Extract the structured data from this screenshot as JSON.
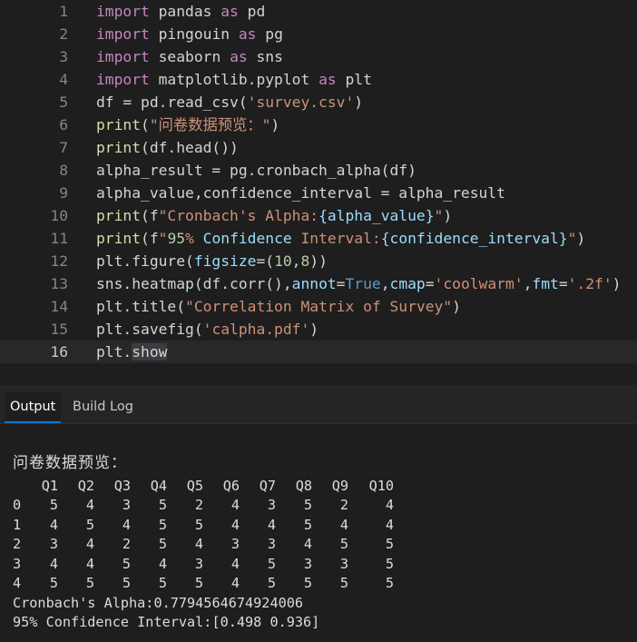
{
  "editor": {
    "current_line": 16,
    "lines": [
      {
        "n": "1",
        "tokens": [
          [
            "import",
            "k-import"
          ],
          [
            " pandas ",
            "k-plain"
          ],
          [
            "as",
            "k-import"
          ],
          [
            " pd",
            "k-plain"
          ]
        ]
      },
      {
        "n": "2",
        "tokens": [
          [
            "import",
            "k-import"
          ],
          [
            " pingouin ",
            "k-plain"
          ],
          [
            "as",
            "k-import"
          ],
          [
            " pg",
            "k-plain"
          ]
        ]
      },
      {
        "n": "3",
        "tokens": [
          [
            "import",
            "k-import"
          ],
          [
            " seaborn ",
            "k-plain"
          ],
          [
            "as",
            "k-import"
          ],
          [
            " sns",
            "k-plain"
          ]
        ]
      },
      {
        "n": "4",
        "tokens": [
          [
            "import",
            "k-import"
          ],
          [
            " matplotlib.pyplot ",
            "k-plain"
          ],
          [
            "as",
            "k-import"
          ],
          [
            " plt",
            "k-plain"
          ]
        ]
      },
      {
        "n": "5",
        "tokens": [
          [
            "df = pd.read_csv(",
            "k-plain"
          ],
          [
            "'survey.csv'",
            "k-str"
          ],
          [
            ")",
            "k-plain"
          ]
        ]
      },
      {
        "n": "6",
        "tokens": [
          [
            "print",
            "k-fn"
          ],
          [
            "(",
            "k-plain"
          ],
          [
            "\"问卷数据预览：\"",
            "k-str"
          ],
          [
            ")",
            "k-plain"
          ]
        ]
      },
      {
        "n": "7",
        "tokens": [
          [
            "print",
            "k-fn"
          ],
          [
            "(df.head())",
            "k-plain"
          ]
        ]
      },
      {
        "n": "8",
        "tokens": [
          [
            "alpha_result = pg.cronbach_alpha(df)",
            "k-plain"
          ]
        ]
      },
      {
        "n": "9",
        "tokens": [
          [
            "alpha_value,confidence_interval = alpha_result",
            "k-plain"
          ]
        ]
      },
      {
        "n": "10",
        "tokens": [
          [
            "print",
            "k-fn"
          ],
          [
            "(f",
            "k-plain"
          ],
          [
            "\"Cronbach's Alpha:",
            "k-str"
          ],
          [
            "{alpha_value}",
            "k-param"
          ],
          [
            "\"",
            "k-str"
          ],
          [
            ")",
            "k-plain"
          ]
        ]
      },
      {
        "n": "11",
        "tokens": [
          [
            "print",
            "k-fn"
          ],
          [
            "(f",
            "k-plain"
          ],
          [
            "\"",
            "k-str"
          ],
          [
            "95",
            "k-num"
          ],
          [
            "% ",
            "k-str"
          ],
          [
            "Confidence",
            "k-param"
          ],
          [
            " Interval:",
            "k-str"
          ],
          [
            "{confidence_interval}",
            "k-param"
          ],
          [
            "\"",
            "k-str"
          ],
          [
            ")",
            "k-plain"
          ]
        ]
      },
      {
        "n": "12",
        "tokens": [
          [
            "plt.figure(",
            "k-plain"
          ],
          [
            "figsize",
            "k-param"
          ],
          [
            "=(",
            "k-plain"
          ],
          [
            "10",
            "k-num"
          ],
          [
            ",",
            "k-plain"
          ],
          [
            "8",
            "k-num"
          ],
          [
            "))",
            "k-plain"
          ]
        ]
      },
      {
        "n": "13",
        "tokens": [
          [
            "sns.heatmap(df.corr(),",
            "k-plain"
          ],
          [
            "annot",
            "k-param"
          ],
          [
            "=",
            "k-plain"
          ],
          [
            "True",
            "k-const"
          ],
          [
            ",",
            "k-plain"
          ],
          [
            "cmap",
            "k-param"
          ],
          [
            "=",
            "k-plain"
          ],
          [
            "'coolwarm'",
            "k-str"
          ],
          [
            ",",
            "k-plain"
          ],
          [
            "fmt",
            "k-param"
          ],
          [
            "=",
            "k-plain"
          ],
          [
            "'.2f'",
            "k-str"
          ],
          [
            ")",
            "k-plain"
          ]
        ]
      },
      {
        "n": "14",
        "tokens": [
          [
            "plt.title(",
            "k-plain"
          ],
          [
            "\"Correlation Matrix of Survey\"",
            "k-str"
          ],
          [
            ")",
            "k-plain"
          ]
        ]
      },
      {
        "n": "15",
        "tokens": [
          [
            "plt.savefig(",
            "k-plain"
          ],
          [
            "'calpha.pdf'",
            "k-str"
          ],
          [
            ")",
            "k-plain"
          ]
        ]
      },
      {
        "n": "16",
        "tokens": [
          [
            "plt.",
            "k-plain"
          ],
          [
            "show",
            "cur-word"
          ]
        ]
      }
    ]
  },
  "panel": {
    "tabs": [
      {
        "label": "Output",
        "active": true
      },
      {
        "label": "Build Log",
        "active": false
      }
    ]
  },
  "output": {
    "preview_title": "问卷数据预览：",
    "columns": [
      "Q1",
      "Q2",
      "Q3",
      "Q4",
      "Q5",
      "Q6",
      "Q7",
      "Q8",
      "Q9",
      "Q10"
    ],
    "rows": [
      {
        "index": "0",
        "values": [
          "5",
          "4",
          "3",
          "5",
          "2",
          "4",
          "3",
          "5",
          "2",
          "4"
        ]
      },
      {
        "index": "1",
        "values": [
          "4",
          "5",
          "4",
          "5",
          "5",
          "4",
          "4",
          "5",
          "4",
          "4"
        ]
      },
      {
        "index": "2",
        "values": [
          "3",
          "4",
          "2",
          "5",
          "4",
          "3",
          "3",
          "4",
          "5",
          "5"
        ]
      },
      {
        "index": "3",
        "values": [
          "4",
          "4",
          "5",
          "4",
          "3",
          "4",
          "5",
          "3",
          "3",
          "5"
        ]
      },
      {
        "index": "4",
        "values": [
          "5",
          "5",
          "5",
          "5",
          "5",
          "4",
          "5",
          "5",
          "5",
          "5"
        ]
      }
    ],
    "alpha_line": "Cronbach's Alpha:0.7794564674924006",
    "ci_line": "95% Confidence Interval:[0.498 0.936]"
  }
}
